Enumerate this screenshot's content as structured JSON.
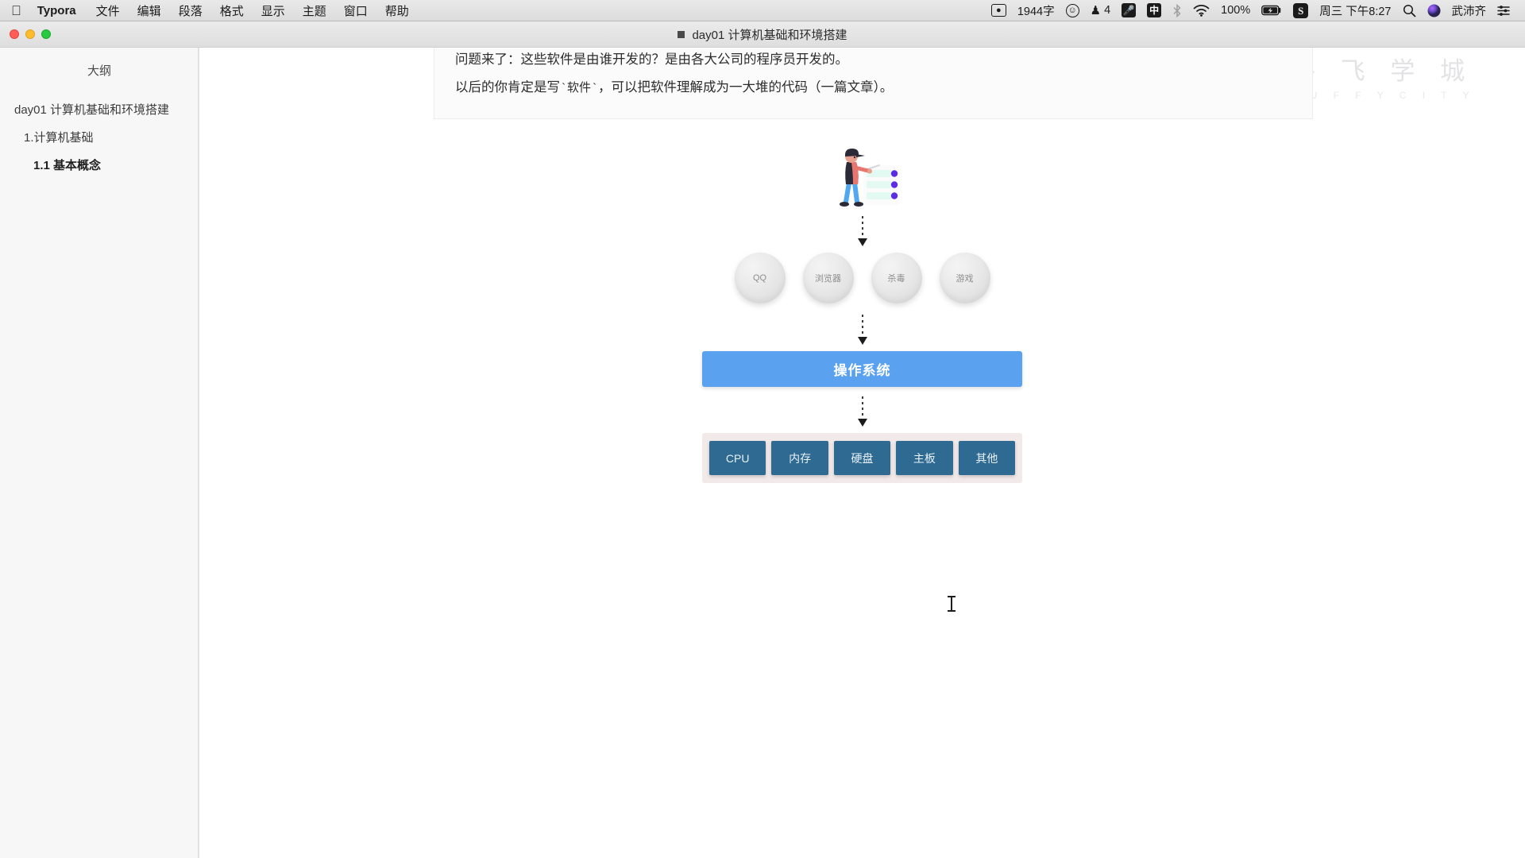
{
  "menubar": {
    "apple_icon": "apple-icon",
    "app_name": "Typora",
    "items": [
      "文件",
      "编辑",
      "段落",
      "格式",
      "显示",
      "主题",
      "窗口",
      "帮助"
    ],
    "status": {
      "screen_record_icon": "screen-record-icon",
      "word_count": "1944字",
      "emoji_icon": "emoji-face-icon",
      "qq_icon": "qq-penguin-icon",
      "qq_count": "4",
      "mic_icon": "microphone-icon",
      "input_method": "中",
      "bluetooth_icon": "bluetooth-icon",
      "wifi_icon": "wifi-icon",
      "battery_percent": "100%",
      "battery_icon": "battery-charging-icon",
      "sogou_icon": "S",
      "datetime": "周三 下午8:27",
      "search_icon": "spotlight-search-icon",
      "siri_icon": "siri-icon",
      "user_name": "武沛齐",
      "control_center_icon": "control-center-icon"
    }
  },
  "window": {
    "traffic_lights": [
      "close",
      "minimize",
      "zoom"
    ],
    "title": "day01 计算机基础和环境搭建"
  },
  "sidebar": {
    "title": "大纲",
    "items": [
      {
        "label": "day01 计算机基础和环境搭建",
        "level": 1
      },
      {
        "label": "1.计算机基础",
        "level": 2
      },
      {
        "label": "1.1 基本概念",
        "level": 3
      }
    ]
  },
  "watermark": {
    "cn": "路 飞 学 城",
    "en": "L U F F Y C I T Y"
  },
  "document": {
    "line_cut": "问题来了：这些软件是由谁开发的？是由各大公司的程序员开发的。",
    "line_2_prefix": "以后的你肯定是写",
    "line_2_code": "`软件`",
    "line_2_suffix": "，可以把软件理解成为一大堆的代码（一篇文章）。"
  },
  "diagram": {
    "illustration_name": "person-with-checklist-illustration",
    "apps": [
      "QQ",
      "浏览器",
      "杀毒",
      "游戏"
    ],
    "os_label": "操作系统",
    "hardware": [
      "CPU",
      "内存",
      "硬盘",
      "主板",
      "其他"
    ],
    "colors": {
      "os_bar": "#5aa2ef",
      "hardware_box": "#2f6a92",
      "hardware_panel": "#f2e9e9",
      "app_circle": "#e9e9e9"
    }
  }
}
